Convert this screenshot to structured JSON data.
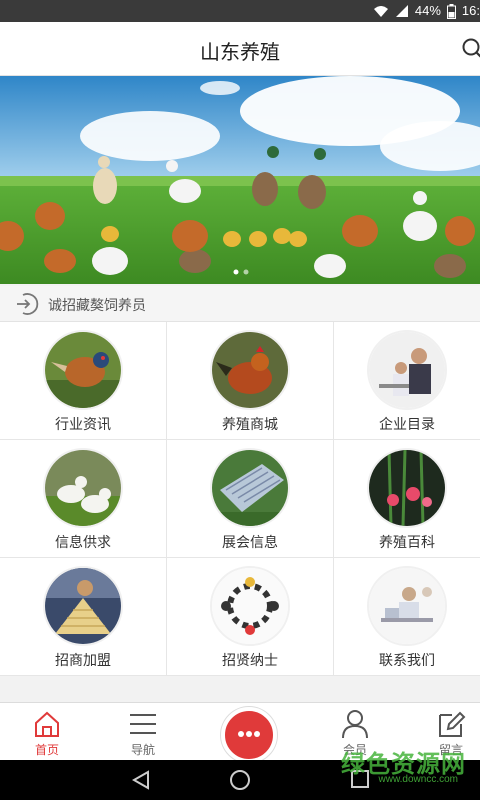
{
  "status_bar": {
    "battery": "44%",
    "time": "16:"
  },
  "header": {
    "title": "山东养殖"
  },
  "notice": {
    "text": "诚招藏獒饲养员"
  },
  "grid": [
    {
      "label": "行业资讯",
      "icon": "pheasant-icon"
    },
    {
      "label": "养殖商城",
      "icon": "rooster-icon"
    },
    {
      "label": "企业目录",
      "icon": "office-people-icon"
    },
    {
      "label": "信息供求",
      "icon": "goats-icon"
    },
    {
      "label": "展会信息",
      "icon": "greenhouse-icon"
    },
    {
      "label": "养殖百科",
      "icon": "flowers-icon"
    },
    {
      "label": "招商加盟",
      "icon": "pyramid-icon"
    },
    {
      "label": "招贤纳士",
      "icon": "people-circle-icon"
    },
    {
      "label": "联系我们",
      "icon": "call-center-icon"
    }
  ],
  "bottom_nav": {
    "home": "首页",
    "nav": "导航",
    "member": "会员",
    "message": "留言"
  },
  "watermark": {
    "text": "绿色资源网",
    "url": "www.downcc.com"
  },
  "colors": {
    "accent": "#e03a3a",
    "header_bg": "#ffffff",
    "status_bg": "#3a3a3a"
  }
}
